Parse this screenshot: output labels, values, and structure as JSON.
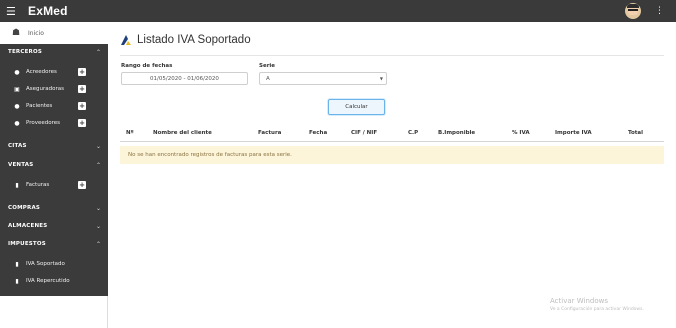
{
  "app": {
    "title": "ExMed"
  },
  "sidebar": {
    "home": {
      "label": "Inicio",
      "icon": "home-icon"
    },
    "sections": [
      {
        "label": "TERCEROS",
        "expanded": true
      },
      {
        "label": "CITAS",
        "expanded": false
      },
      {
        "label": "VENTAS",
        "expanded": true
      },
      {
        "label": "COMPRAS",
        "expanded": false
      },
      {
        "label": "ALMACENES",
        "expanded": false
      },
      {
        "label": "IMPUESTOS",
        "expanded": true
      }
    ],
    "terceros_items": [
      {
        "label": "Acreedores",
        "icon": "user-icon"
      },
      {
        "label": "Aseguradoras",
        "icon": "briefcase-icon"
      },
      {
        "label": "Pacientes",
        "icon": "users-icon"
      },
      {
        "label": "Proveedores",
        "icon": "user-icon"
      }
    ],
    "ventas_items": [
      {
        "label": "Facturas",
        "icon": "document-icon"
      }
    ],
    "impuestos_items": [
      {
        "label": "IVA Soportado",
        "icon": "document-icon"
      },
      {
        "label": "IVA Repercutido",
        "icon": "document-icon"
      }
    ],
    "plus_symbol": "+"
  },
  "main": {
    "title": "Listado IVA Soportado",
    "date_range_label": "Rango de fechas",
    "date_range_value": "01/05/2020 - 01/06/2020",
    "serie_label": "Serie",
    "serie_value": "A",
    "calculate_label": "Calcular",
    "columns": [
      "Nº",
      "Nombre del cliente",
      "Factura",
      "Fecha",
      "CIF / NIF",
      "C.P",
      "B.Imponible",
      "% IVA",
      "Importe IVA",
      "Total"
    ],
    "empty_message": "No se han encontrado registros de facturas para esta serie."
  },
  "watermark": {
    "line1": "Activar Windows",
    "line2": "Ve a Configuración para activar Windows."
  },
  "colors": {
    "topbar": "#3a3a3a",
    "sidebar": "#3b3b3b",
    "accent": "#6bb3e8",
    "warning_bg": "#fcf5da"
  }
}
